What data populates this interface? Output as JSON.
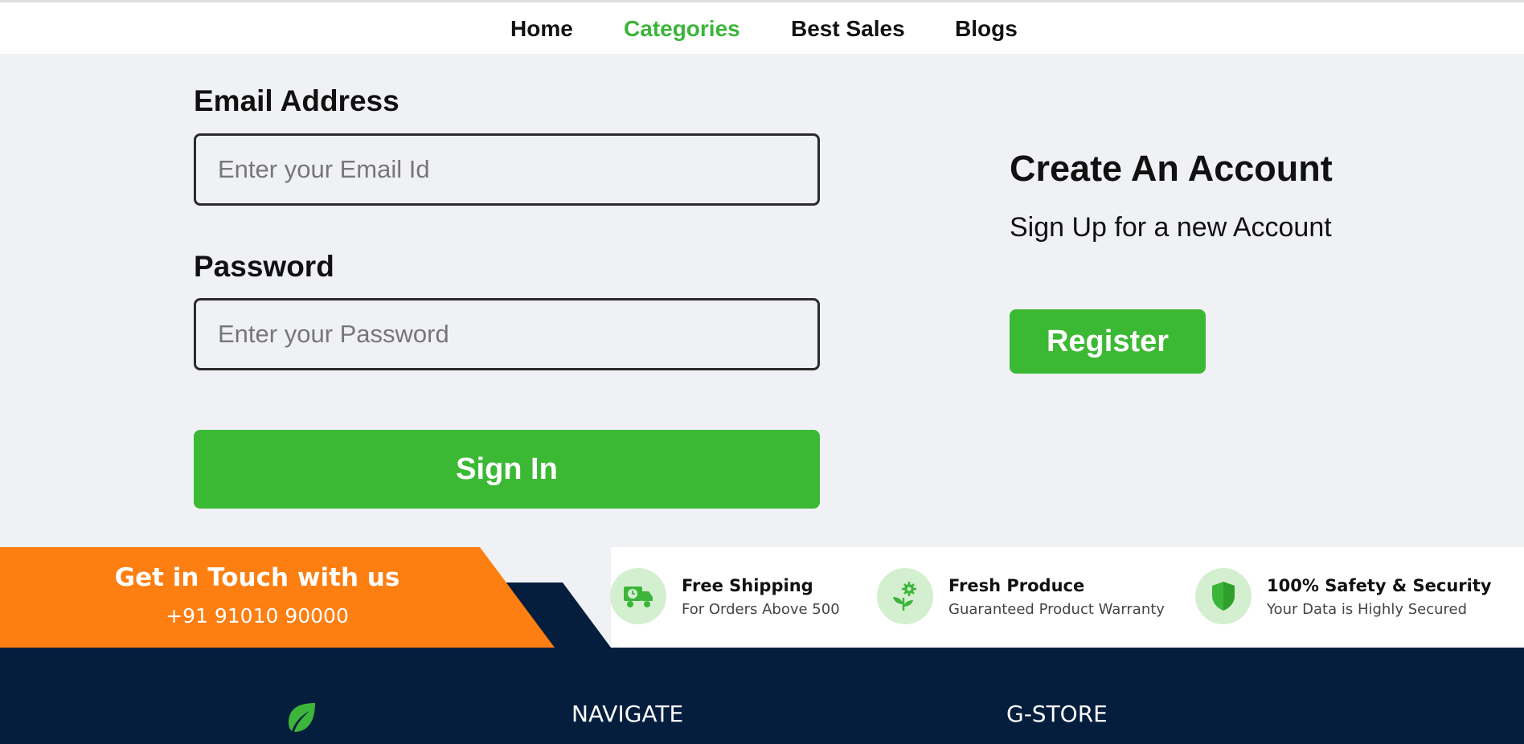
{
  "nav": {
    "links": [
      "Home",
      "Categories",
      "Best Sales",
      "Blogs"
    ],
    "active_color": "#3cb53a"
  },
  "signin": {
    "email_label": "Email Address",
    "email_placeholder": "Enter your Email Id",
    "password_label": "Password",
    "password_placeholder": "Enter your Password",
    "submit_label": "Sign In"
  },
  "account": {
    "title": "Create An Account",
    "subtitle": "Sign Up for a new Account",
    "register_label": "Register"
  },
  "contact": {
    "title": "Get in Touch with us",
    "phone": "+91 91010 90000"
  },
  "features": [
    {
      "icon": "truck-icon",
      "title": "Free Shipping",
      "subtitle": "For Orders Above 500"
    },
    {
      "icon": "plant-gear-icon",
      "title": "Fresh Produce",
      "subtitle": "Guaranteed Product Warranty"
    },
    {
      "icon": "shield-icon",
      "title": "100% Safety & Security",
      "subtitle": "Your Data is Highly Secured"
    }
  ],
  "footer": {
    "logo_icon": "leaf-icon",
    "headings": [
      "NAVIGATE",
      "G-STORE"
    ]
  },
  "colors": {
    "brand_green": "#3cb934",
    "accent_orange": "#fd7e11",
    "navy": "#051e3e",
    "page_bg": "#f0f1f5",
    "icon_circle": "#d4efd0"
  }
}
